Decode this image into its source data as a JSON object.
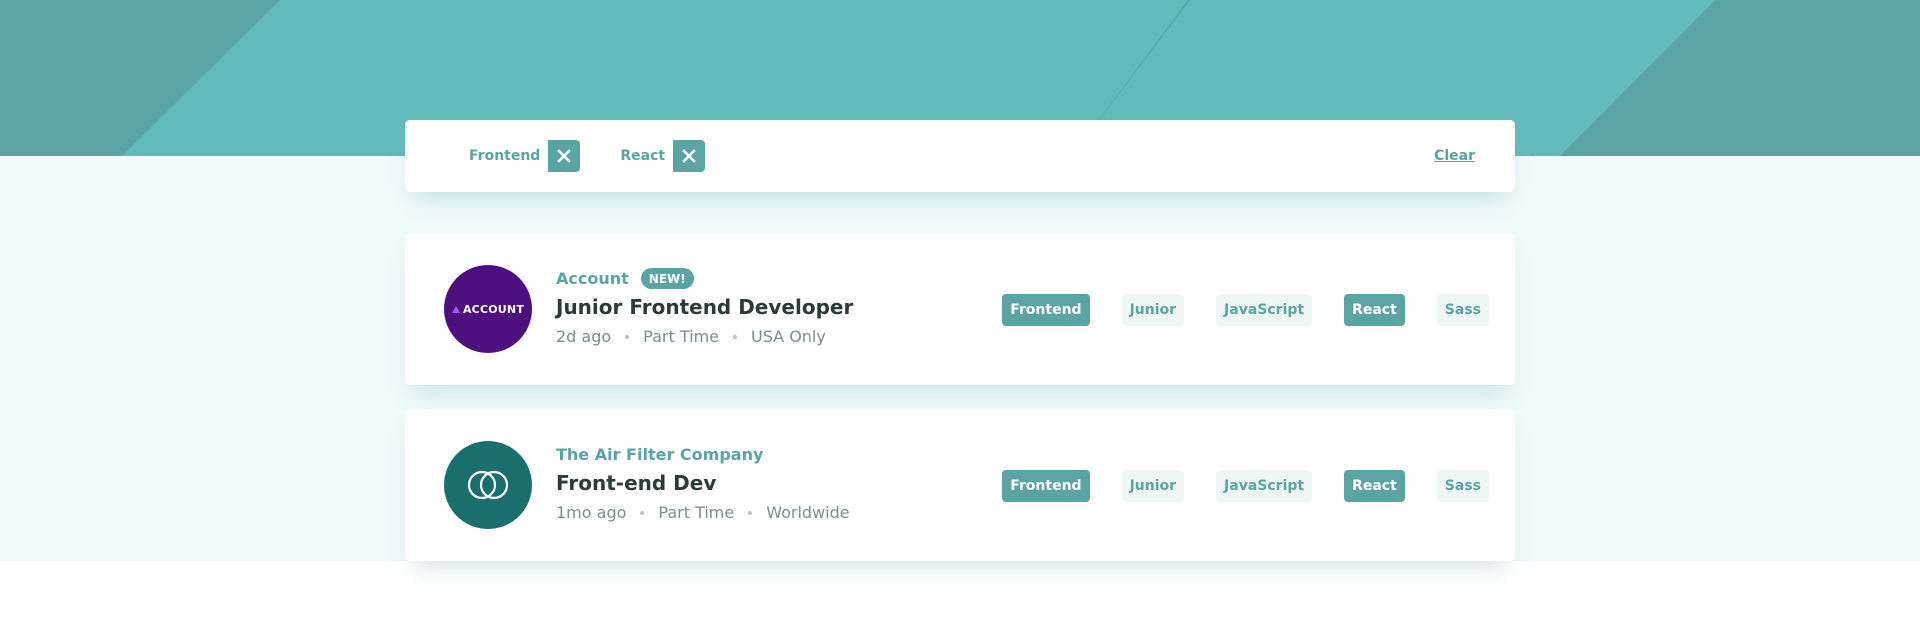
{
  "colors": {
    "primary": "#5ba4a4",
    "header_dark": "#5ba4a4",
    "header_light": "#63babb",
    "page_bg": "#effafa",
    "text_dark": "#2c3a3a",
    "text_muted": "#7b8e8e",
    "tag_bg": "#eef6f6",
    "account_logo": "#4e0f7e",
    "airfilter_logo": "#1a6f6c"
  },
  "filters": {
    "chips": [
      {
        "label": "Frontend",
        "remove_icon": "close-icon"
      },
      {
        "label": "React",
        "remove_icon": "close-icon"
      }
    ],
    "clear_label": "Clear"
  },
  "jobs": [
    {
      "logo_text": "ACCOUNT",
      "company": "Account",
      "badge": "NEW!",
      "position": "Junior Frontend Developer",
      "posted": "2d ago",
      "contract": "Part Time",
      "location": "USA Only",
      "tags": [
        {
          "label": "Frontend",
          "active": true
        },
        {
          "label": "Junior",
          "active": false
        },
        {
          "label": "JavaScript",
          "active": false
        },
        {
          "label": "React",
          "active": true
        },
        {
          "label": "Sass",
          "active": false
        }
      ]
    },
    {
      "logo_icon": "interlocking-rings-icon",
      "company": "The Air Filter Company",
      "position": "Front-end Dev",
      "posted": "1mo ago",
      "contract": "Part Time",
      "location": "Worldwide",
      "tags": [
        {
          "label": "Frontend",
          "active": true
        },
        {
          "label": "Junior",
          "active": false
        },
        {
          "label": "JavaScript",
          "active": false
        },
        {
          "label": "React",
          "active": true
        },
        {
          "label": "Sass",
          "active": false
        }
      ]
    }
  ]
}
